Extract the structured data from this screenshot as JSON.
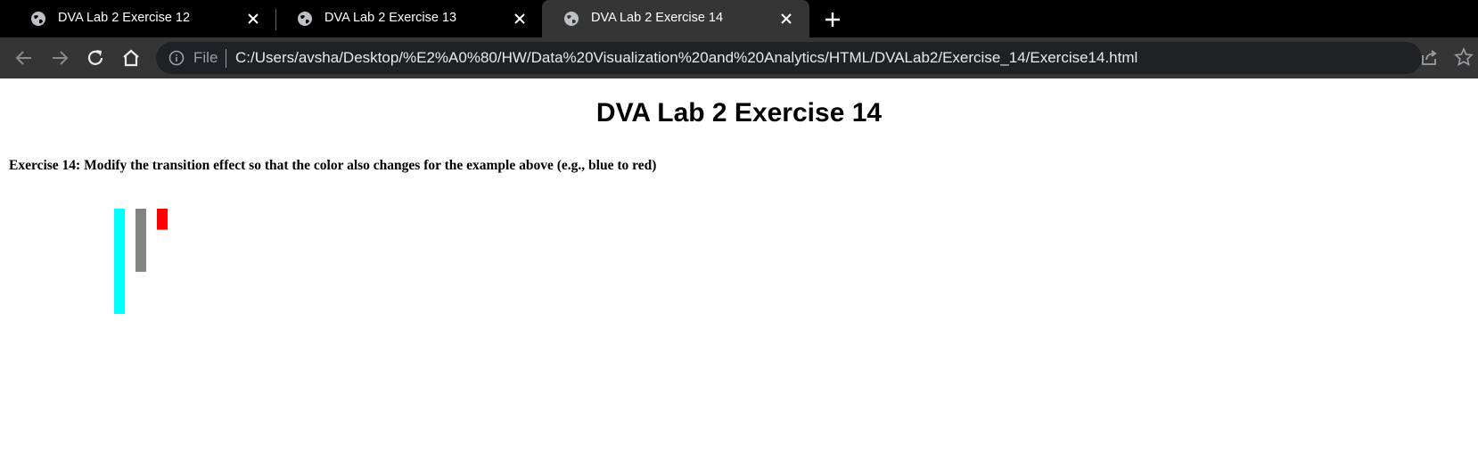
{
  "tabs": [
    {
      "title": "DVA Lab 2 Exercise 12",
      "active": false
    },
    {
      "title": "DVA Lab 2 Exercise 13",
      "active": false
    },
    {
      "title": "DVA Lab 2 Exercise 14",
      "active": true
    }
  ],
  "toolbar": {
    "icons": [
      "back-icon",
      "forward-icon",
      "reload-icon",
      "home-icon"
    ],
    "right_icons": [
      "share-icon",
      "bookmark-star-icon"
    ]
  },
  "omnibox": {
    "scheme_label": "File",
    "url": "C:/Users/avsha/Desktop/%E2%A0%80/HW/Data%20Visualization%20and%20Analytics/HTML/DVALab2/Exercise_14/Exercise14.html"
  },
  "page": {
    "heading": "DVA Lab 2 Exercise 14",
    "exercise_text": "Exercise 14: Modify the transition effect so that the color also changes for the example above (e.g., blue to red)"
  },
  "colors": {
    "chrome_bg": "#000000",
    "toolbar_bg": "#353535",
    "omnibox_bg": "#202124"
  },
  "chart_data": {
    "type": "bar",
    "series": [
      {
        "values": [
          50,
          30,
          10
        ],
        "colors": [
          "#00ffff",
          "#808580",
          "#ff0000"
        ]
      }
    ],
    "ylim": [
      0,
      50
    ]
  }
}
